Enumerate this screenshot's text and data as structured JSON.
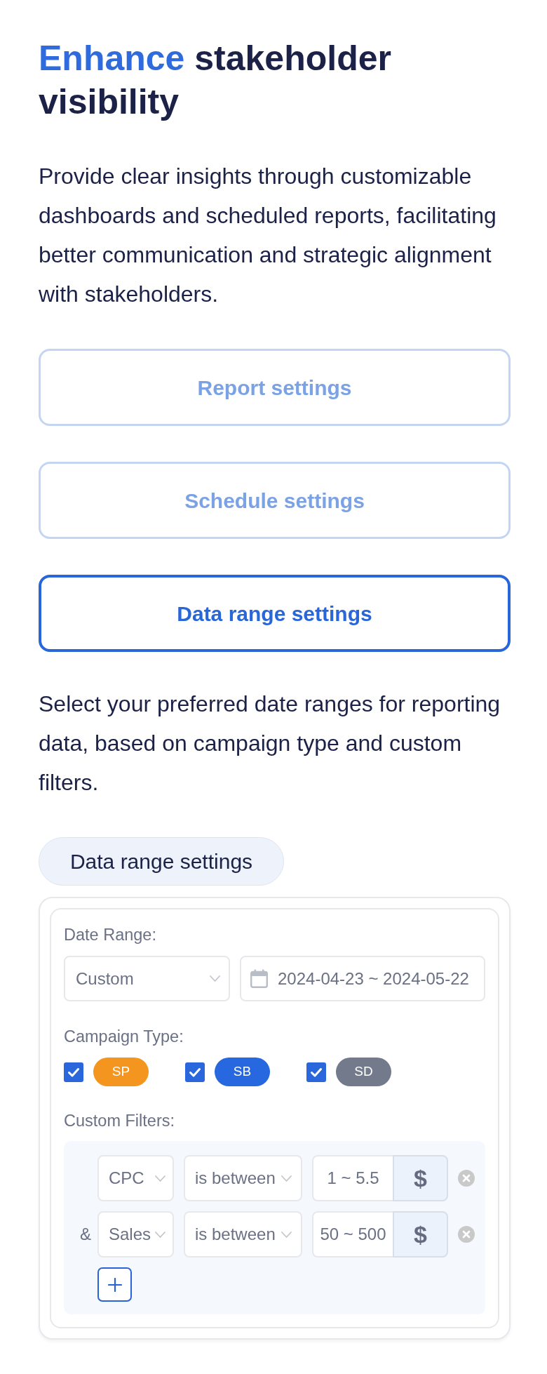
{
  "heading": {
    "accent": "Enhance",
    "rest": "stakeholder visibility"
  },
  "intro": "Provide clear insights through customizable dashboards and scheduled reports, facilitating better communication and strategic alignment with stakeholders.",
  "tabs": [
    {
      "label": "Report settings",
      "selected": false
    },
    {
      "label": "Schedule settings",
      "selected": false
    },
    {
      "label": "Data range settings",
      "selected": true
    }
  ],
  "section": {
    "description": "Select your preferred date ranges for reporting data, based on campaign type and custom filters.",
    "panel_title": "Data range settings",
    "date_range": {
      "label": "Date Range:",
      "preset": "Custom",
      "dates": "2024-04-23 ~ 2024-05-22"
    },
    "campaign_type": {
      "label": "Campaign Type:",
      "options": [
        {
          "label": "SP",
          "checked": true,
          "color": "#f3951f"
        },
        {
          "label": "SB",
          "checked": true,
          "color": "#2767e0"
        },
        {
          "label": "SD",
          "checked": true,
          "color": "#737a8c"
        }
      ]
    },
    "custom_filters": {
      "label": "Custom Filters:",
      "rows": [
        {
          "metric": "CPC",
          "operator": "is between",
          "value": "1 ~ 5.5",
          "unit": "$"
        },
        {
          "joiner": "&",
          "metric": "Sales",
          "operator": "is between",
          "value": "50 ~ 500",
          "unit": "$"
        }
      ]
    }
  }
}
